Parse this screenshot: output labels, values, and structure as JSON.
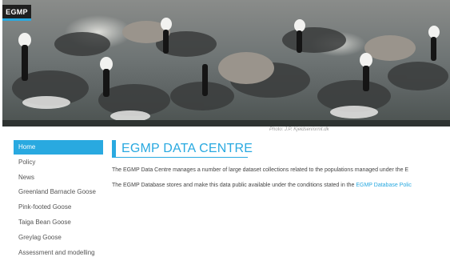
{
  "header": {
    "logo_text": "EGMP",
    "photo_credit": "Photo: J.P. Kjeldsen/ornit.dk"
  },
  "sidebar": {
    "items": [
      {
        "label": "Home",
        "active": true
      },
      {
        "label": "Policy",
        "active": false
      },
      {
        "label": "News",
        "active": false
      },
      {
        "label": "Greenland Barnacle Goose",
        "active": false
      },
      {
        "label": "Pink-footed Goose",
        "active": false
      },
      {
        "label": "Taiga Bean Goose",
        "active": false
      },
      {
        "label": "Greylag Goose",
        "active": false
      },
      {
        "label": "Assessment and modelling",
        "active": false
      }
    ]
  },
  "main": {
    "title": "EGMP DATA CENTRE",
    "paragraph1": "The EGMP Data Centre manages a number of large dataset collections related to the populations managed under the E",
    "paragraph2_text": "The EGMP Database stores and make this data public available under the conditions stated in the ",
    "paragraph2_link": "EGMP Database Polic"
  },
  "colors": {
    "accent": "#29a9e0",
    "logo_bg": "#1f1f1f"
  }
}
